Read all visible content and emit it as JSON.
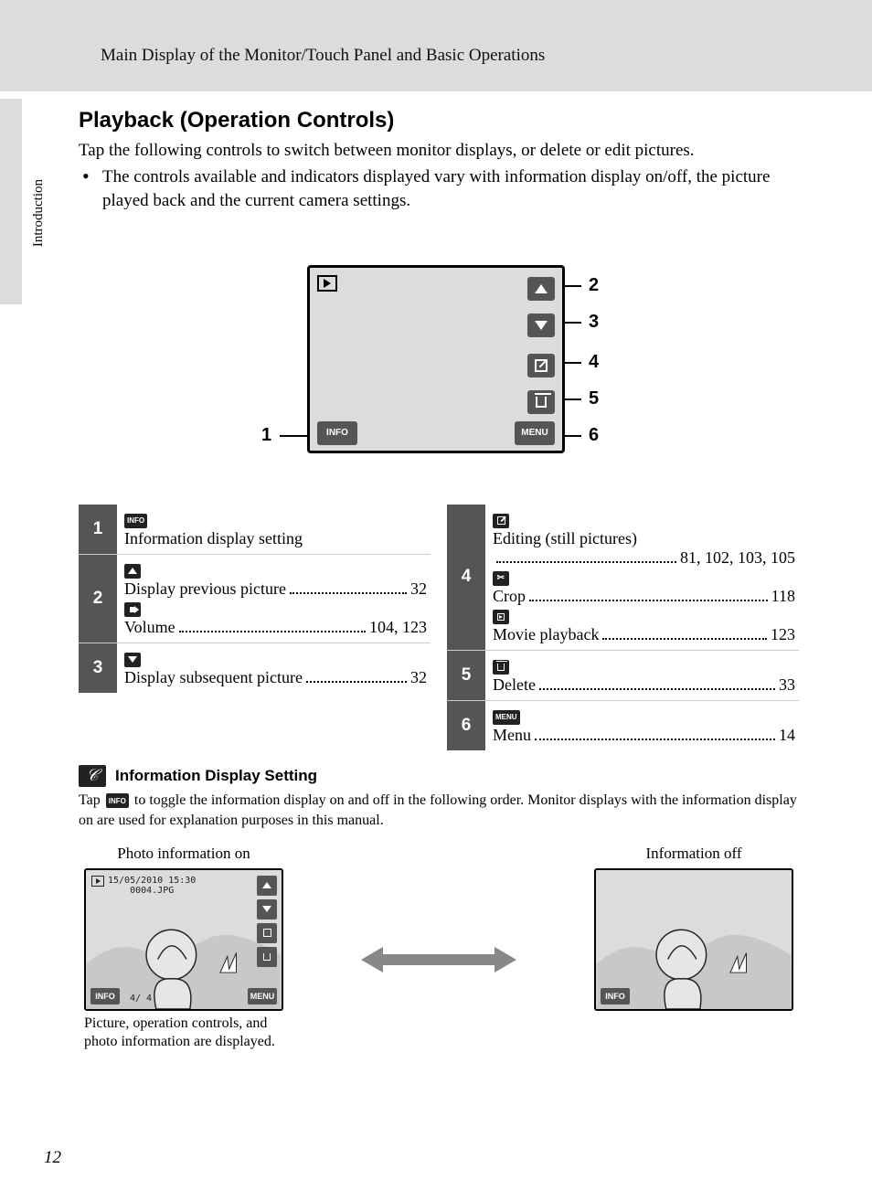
{
  "breadcrumb": "Main Display of the Monitor/Touch Panel and Basic Operations",
  "side_tab": "Introduction",
  "heading": "Playback (Operation Controls)",
  "intro": "Tap the following controls to switch between monitor displays, or delete or edit pictures.",
  "bullet1": "The controls available and indicators displayed vary with information display on/off, the picture played back and the current camera settings.",
  "diagram": {
    "callout_1": "1",
    "callout_2": "2",
    "callout_3": "3",
    "callout_4": "4",
    "callout_5": "5",
    "callout_6": "6",
    "info_label": "INFO",
    "menu_label": "MENU"
  },
  "table_left": [
    {
      "num": "1",
      "rows": [
        {
          "icon": "INFO",
          "text": "Information display setting",
          "page": ""
        }
      ]
    },
    {
      "num": "2",
      "rows": [
        {
          "icon": "up",
          "text": "Display previous picture",
          "page": "32"
        },
        {
          "icon": "sound",
          "text": "Volume",
          "page": "104, 123"
        }
      ]
    },
    {
      "num": "3",
      "rows": [
        {
          "icon": "down",
          "text": "Display subsequent picture",
          "page": "32"
        }
      ]
    }
  ],
  "table_right": [
    {
      "num": "4",
      "rows": [
        {
          "icon": "edit",
          "text": "Editing (still pictures)",
          "page": "81, 102, 103, 105",
          "dots_below": true
        },
        {
          "icon": "crop",
          "text": "Crop",
          "page": "118"
        },
        {
          "icon": "play",
          "text": "Movie playback",
          "page": "123"
        }
      ]
    },
    {
      "num": "5",
      "rows": [
        {
          "icon": "trash",
          "text": "Delete",
          "page": "33"
        }
      ]
    },
    {
      "num": "6",
      "rows": [
        {
          "icon": "MENU",
          "text": "Menu",
          "page": "14"
        }
      ]
    }
  ],
  "note_title": "Information Display Setting",
  "note_text_pre": "Tap ",
  "note_text_post": " to toggle the information display on and off in the following order. Monitor displays with the information display on are used for explanation purposes in this manual.",
  "examples": {
    "left_label": "Photo information on",
    "left_date": "15/05/2010 15:30",
    "left_file": "0004.JPG",
    "left_bottom": "   4/   4",
    "left_caption": "Picture, operation controls, and photo information are displayed.",
    "right_label": "Information off"
  },
  "page_number": "12",
  "icon_labels": {
    "info": "INFO",
    "menu": "MENU"
  }
}
